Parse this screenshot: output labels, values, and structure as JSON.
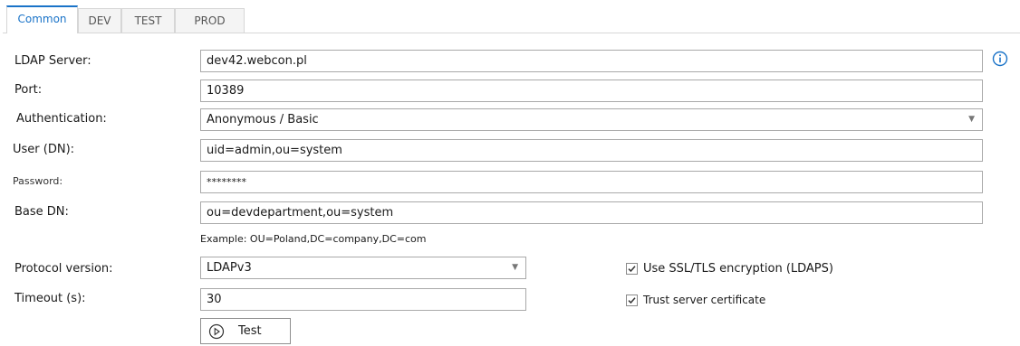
{
  "tabs": [
    {
      "label": "Common",
      "active": true
    },
    {
      "label": "DEV",
      "active": false
    },
    {
      "label": "TEST",
      "active": false
    },
    {
      "label": "PROD",
      "active": false
    }
  ],
  "form": {
    "ldap_server": {
      "label": "LDAP Server:",
      "value": "dev42.webcon.pl"
    },
    "port": {
      "label": "Port:",
      "value": "10389"
    },
    "authentication": {
      "label": "Authentication:",
      "value": "Anonymous / Basic"
    },
    "user": {
      "label": "User (DN):",
      "value": "uid=admin,ou=system"
    },
    "password": {
      "label": "Password:",
      "value": "********"
    },
    "base_dn": {
      "label": "Base DN:",
      "value": "ou=devdepartment,ou=system",
      "example": "Example: OU=Poland,DC=company,DC=com"
    },
    "protocol_version": {
      "label": "Protocol version:",
      "value": "LDAPv3"
    },
    "timeout": {
      "label": "Timeout (s):",
      "value": "30"
    },
    "use_ssl": {
      "label": "Use SSL/TLS encryption (LDAPS)",
      "checked": true
    },
    "trust_cert": {
      "label": "Trust server certificate",
      "checked": true
    },
    "test_button": {
      "label": "Test"
    }
  },
  "icons": {
    "info": "info-icon",
    "play": "play-circle-icon",
    "dropdown": "chevron-down-icon"
  },
  "colors": {
    "accent": "#1a73c8"
  }
}
